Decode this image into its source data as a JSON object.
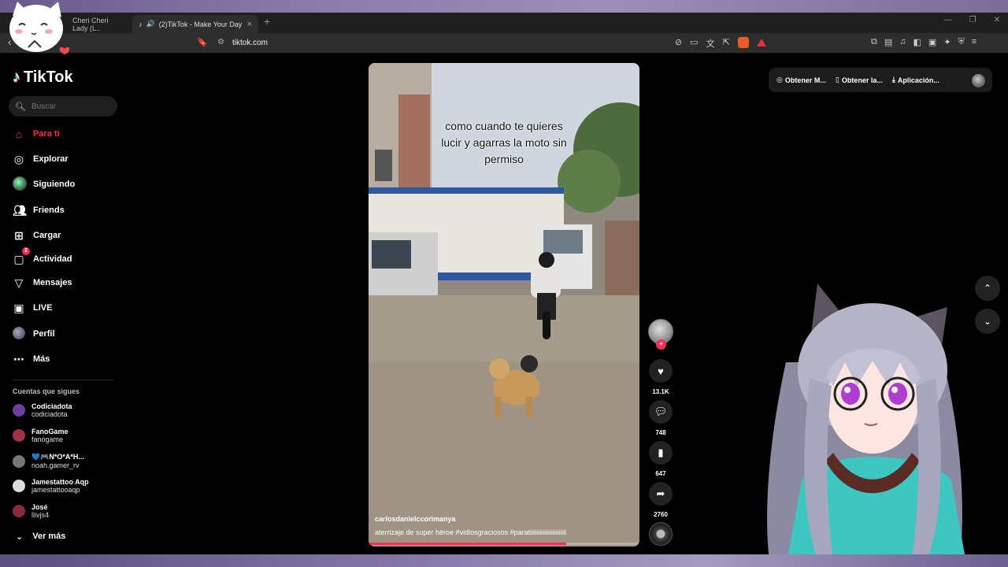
{
  "browser": {
    "tabs": [
      {
        "title": "Cheri Cheri Lady (L..",
        "active": false
      },
      {
        "title": "(2)TikTok - Make Your Day",
        "active": true
      }
    ],
    "url": "tiktok.com",
    "new_tab": "+",
    "close_tab": "×"
  },
  "app": {
    "name": "TikTok"
  },
  "search": {
    "placeholder": "Buscar"
  },
  "nav": [
    {
      "label": "Para ti",
      "icon": "home-icon",
      "active": true
    },
    {
      "label": "Explorar",
      "icon": "compass-icon"
    },
    {
      "label": "Siguiendo",
      "icon": "following-avatar-icon"
    },
    {
      "label": "Friends",
      "icon": "friends-icon"
    },
    {
      "label": "Cargar",
      "icon": "upload-icon"
    },
    {
      "label": "Actividad",
      "icon": "activity-icon",
      "badge": "2"
    },
    {
      "label": "Mensajes",
      "icon": "send-icon"
    },
    {
      "label": "LIVE",
      "icon": "live-icon"
    },
    {
      "label": "Perfil",
      "icon": "profile-avatar-icon"
    },
    {
      "label": "Más",
      "icon": "more-icon"
    }
  ],
  "following": {
    "title": "Cuentas que sigues",
    "accounts": [
      {
        "name": "Codiciadota",
        "handle": "codiciadota",
        "color": "#6b3fa0"
      },
      {
        "name": "FanoGame",
        "handle": "fanogame",
        "color": "#a0304a"
      },
      {
        "name": "💙🎮N*O*A*H...",
        "handle": "noah.gamer_rv",
        "color": "#777777"
      },
      {
        "name": "Jamestattoo Aqp",
        "handle": "jamestattooaqp",
        "color": "#dddddd"
      },
      {
        "name": "José",
        "handle": "llivjs4",
        "color": "#8a2a3a"
      }
    ],
    "see_more": "Ver más"
  },
  "video": {
    "caption_lines": [
      "como cuando te quieres",
      "lucir y agarras la moto sin",
      "permiso"
    ],
    "author": "carlosdanielccorimanya",
    "description": "aterrizaje de super héroe #vidiosgraciosos  #paratiiiiiiiiiiiiiiiiiiiiiii",
    "progress": 0.73
  },
  "actions": {
    "likes": "13.1K",
    "comments": "748",
    "saves": "647",
    "shares": "2760"
  },
  "top_right": {
    "items": [
      "Obtener M...",
      "Obtener la...",
      "Aplicación..."
    ]
  },
  "colors": {
    "accent": "#fe2c55",
    "background": "#000000"
  }
}
